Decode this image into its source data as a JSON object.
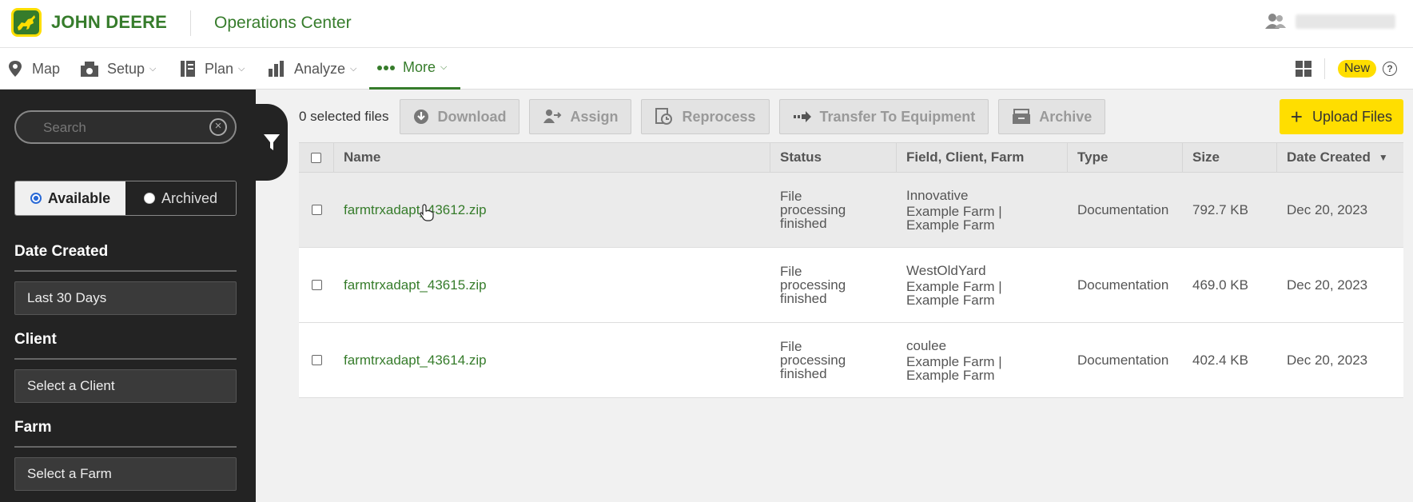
{
  "header": {
    "brand": "JOHN DEERE",
    "app_title": "Operations Center"
  },
  "nav": {
    "items": [
      {
        "label": "Map",
        "icon": "map-pin-icon"
      },
      {
        "label": "Setup",
        "icon": "setup-icon"
      },
      {
        "label": "Plan",
        "icon": "plan-icon"
      },
      {
        "label": "Analyze",
        "icon": "analyze-icon"
      },
      {
        "label": "More",
        "icon": "more-dots-icon"
      }
    ],
    "new_badge": "New",
    "help": "?"
  },
  "sidebar": {
    "search_placeholder": "Search",
    "toggle": {
      "available": "Available",
      "archived": "Archived",
      "selected": "Available"
    },
    "date_created": {
      "heading": "Date Created",
      "value": "Last 30 Days"
    },
    "client": {
      "heading": "Client",
      "value": "Select a Client"
    },
    "farm": {
      "heading": "Farm",
      "value": "Select a Farm"
    }
  },
  "toolbar": {
    "selected": "0 selected files",
    "download": "Download",
    "assign": "Assign",
    "reprocess": "Reprocess",
    "transfer": "Transfer To Equipment",
    "archive": "Archive",
    "upload": "Upload Files"
  },
  "table": {
    "columns": [
      "Name",
      "Status",
      "Field, Client, Farm",
      "Type",
      "Size",
      "Date Created"
    ],
    "rows": [
      {
        "name": "farmtrxadapt_43612.zip",
        "status": [
          "File",
          "processing",
          "finished"
        ],
        "field": "Innovative",
        "client_farm": [
          "Example Farm |",
          "Example Farm"
        ],
        "type": "Documentation",
        "size": "792.7 KB",
        "date": "Dec 20, 2023"
      },
      {
        "name": "farmtrxadapt_43615.zip",
        "status": [
          "File",
          "processing",
          "finished"
        ],
        "field": "WestOldYard",
        "client_farm": [
          "Example Farm |",
          "Example Farm"
        ],
        "type": "Documentation",
        "size": "469.0 KB",
        "date": "Dec 20, 2023"
      },
      {
        "name": "farmtrxadapt_43614.zip",
        "status": [
          "File",
          "processing",
          "finished"
        ],
        "field": "coulee",
        "client_farm": [
          "Example Farm |",
          "Example Farm"
        ],
        "type": "Documentation",
        "size": "402.4 KB",
        "date": "Dec 20, 2023"
      }
    ]
  },
  "colors": {
    "brand_green": "#367c2b",
    "brand_yellow": "#ffde00",
    "sidebar_bg": "#232323"
  }
}
